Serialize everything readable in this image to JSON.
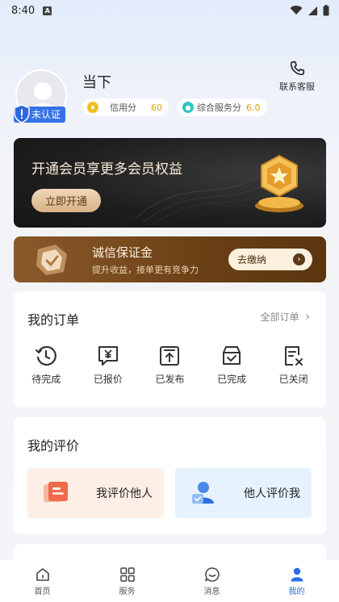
{
  "status_bar": {
    "time": "8:40"
  },
  "profile": {
    "username": "当下",
    "verify_label": "未认证",
    "credit_label": "信用分",
    "credit_value": "60",
    "service_label": "综合服务分",
    "service_value": "6.0",
    "contact_label": "联系客服"
  },
  "vip": {
    "title": "开通会员享更多会员权益",
    "button": "立即开通"
  },
  "deposit": {
    "title": "诚信保证金",
    "subtitle": "提升收益，接单更有竞争力",
    "button": "去缴纳"
  },
  "orders": {
    "title": "我的订单",
    "all_label": "全部订单",
    "items": [
      {
        "label": "待完成",
        "icon": "clock-icon"
      },
      {
        "label": "已报价",
        "icon": "yuan-chat-icon"
      },
      {
        "label": "已发布",
        "icon": "upload-box-icon"
      },
      {
        "label": "已完成",
        "icon": "check-box-icon"
      },
      {
        "label": "已关闭",
        "icon": "doc-close-icon"
      }
    ]
  },
  "reviews": {
    "title": "我的评价",
    "left_label": "我评价他人",
    "right_label": "他人评价我"
  },
  "tabs": [
    {
      "label": "首页",
      "icon": "home-icon"
    },
    {
      "label": "服务",
      "icon": "grid-icon"
    },
    {
      "label": "消息",
      "icon": "message-icon"
    },
    {
      "label": "我的",
      "icon": "person-icon",
      "active": true
    }
  ],
  "colors": {
    "accent": "#2b6de6",
    "vip_gold": "#d8b387",
    "deposit_brown": "#6a4015"
  }
}
